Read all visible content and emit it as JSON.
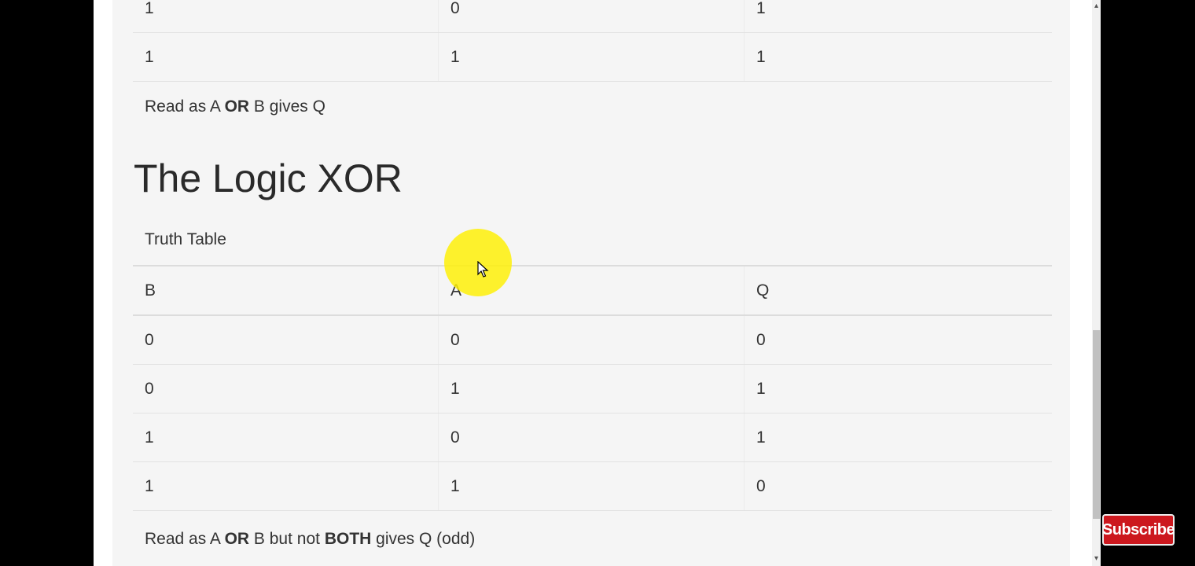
{
  "or_table": {
    "rows": [
      [
        "1",
        "0",
        "1"
      ],
      [
        "1",
        "1",
        "1"
      ]
    ],
    "caption_pre": "Read as A ",
    "caption_bold": "OR",
    "caption_post": " B gives Q"
  },
  "xor_section": {
    "heading": "The Logic XOR",
    "subtitle": "Truth Table",
    "headers": [
      "B",
      "A",
      "Q"
    ],
    "rows": [
      [
        "0",
        "0",
        "0"
      ],
      [
        "0",
        "1",
        "1"
      ],
      [
        "1",
        "0",
        "1"
      ],
      [
        "1",
        "1",
        "0"
      ]
    ],
    "caption_pre": "Read as A ",
    "caption_bold1": "OR",
    "caption_mid": " B but not ",
    "caption_bold2": "BOTH",
    "caption_post": " gives Q (odd)"
  },
  "overlay": {
    "subscribe_label": "Subscribe"
  }
}
